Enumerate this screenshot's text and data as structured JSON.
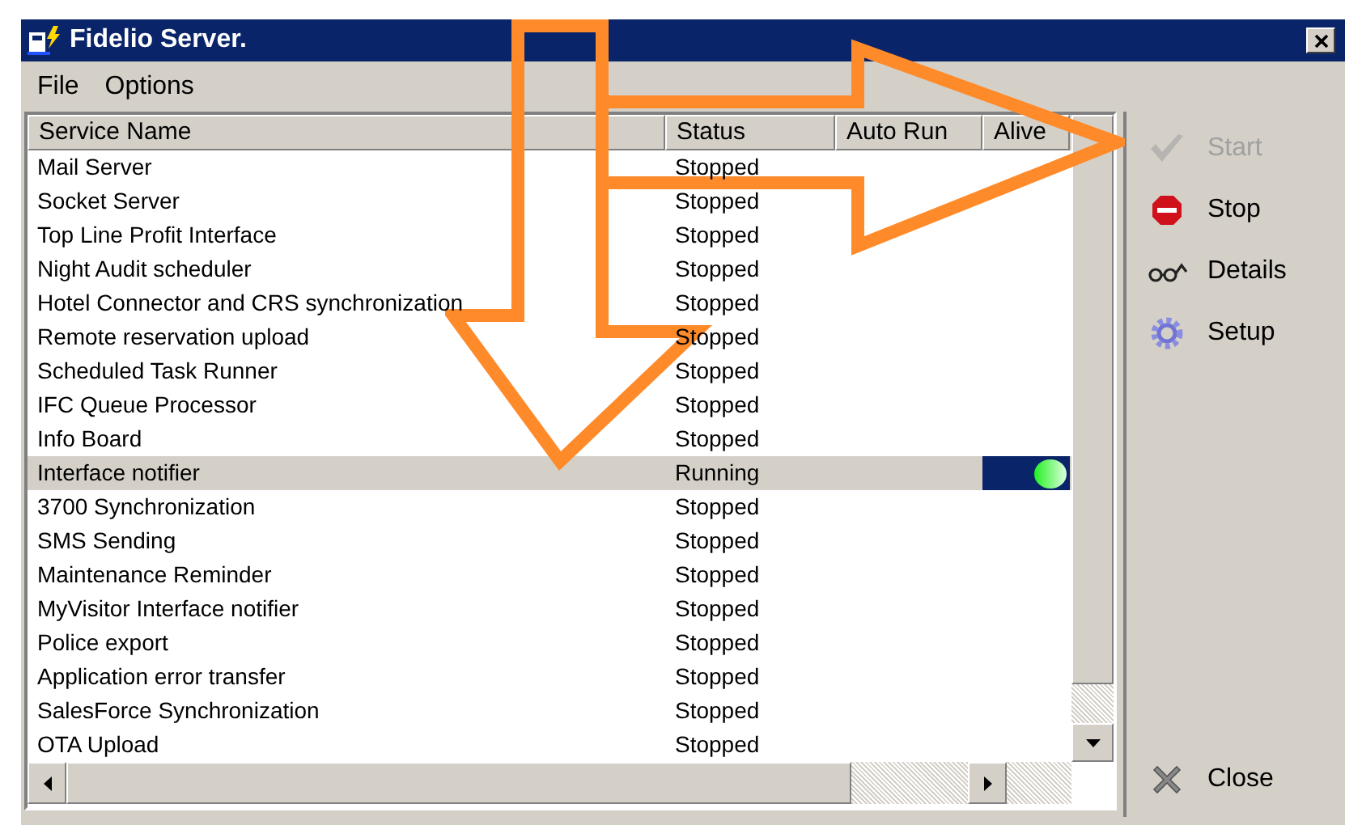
{
  "window": {
    "title": "Fidelio Server."
  },
  "menu": [
    "File",
    "Options"
  ],
  "table": {
    "columns": [
      "Service Name",
      "Status",
      "Auto Run",
      "Alive"
    ],
    "rows": [
      {
        "name": "Mail Server",
        "status": "Stopped",
        "selected": false,
        "alive": false
      },
      {
        "name": "Socket Server",
        "status": "Stopped",
        "selected": false,
        "alive": false
      },
      {
        "name": "Top Line Profit Interface",
        "status": "Stopped",
        "selected": false,
        "alive": false
      },
      {
        "name": "Night Audit scheduler",
        "status": "Stopped",
        "selected": false,
        "alive": false
      },
      {
        "name": "Hotel Connector and CRS synchronization",
        "status": "Stopped",
        "selected": false,
        "alive": false
      },
      {
        "name": "Remote reservation upload",
        "status": "Stopped",
        "selected": false,
        "alive": false
      },
      {
        "name": "Scheduled Task Runner",
        "status": "Stopped",
        "selected": false,
        "alive": false
      },
      {
        "name": "IFC Queue Processor",
        "status": "Stopped",
        "selected": false,
        "alive": false
      },
      {
        "name": "Info Board",
        "status": "Stopped",
        "selected": false,
        "alive": false
      },
      {
        "name": "Interface notifier",
        "status": "Running",
        "selected": true,
        "alive": true
      },
      {
        "name": "3700 Synchronization",
        "status": "Stopped",
        "selected": false,
        "alive": false
      },
      {
        "name": "SMS Sending",
        "status": "Stopped",
        "selected": false,
        "alive": false
      },
      {
        "name": "Maintenance Reminder",
        "status": "Stopped",
        "selected": false,
        "alive": false
      },
      {
        "name": "MyVisitor Interface notifier",
        "status": "Stopped",
        "selected": false,
        "alive": false
      },
      {
        "name": "Police export",
        "status": "Stopped",
        "selected": false,
        "alive": false
      },
      {
        "name": "Application error transfer",
        "status": "Stopped",
        "selected": false,
        "alive": false
      },
      {
        "name": "SalesForce Synchronization",
        "status": "Stopped",
        "selected": false,
        "alive": false
      },
      {
        "name": "OTA Upload",
        "status": "Stopped",
        "selected": false,
        "alive": false
      }
    ]
  },
  "actions": [
    {
      "kind": "start",
      "label": "Start",
      "disabled": true
    },
    {
      "kind": "stop",
      "label": "Stop",
      "disabled": false
    },
    {
      "kind": "details",
      "label": "Details",
      "disabled": false
    },
    {
      "kind": "setup",
      "label": "Setup",
      "disabled": false
    }
  ],
  "close_button": {
    "kind": "close",
    "label": "Close",
    "disabled": false
  }
}
